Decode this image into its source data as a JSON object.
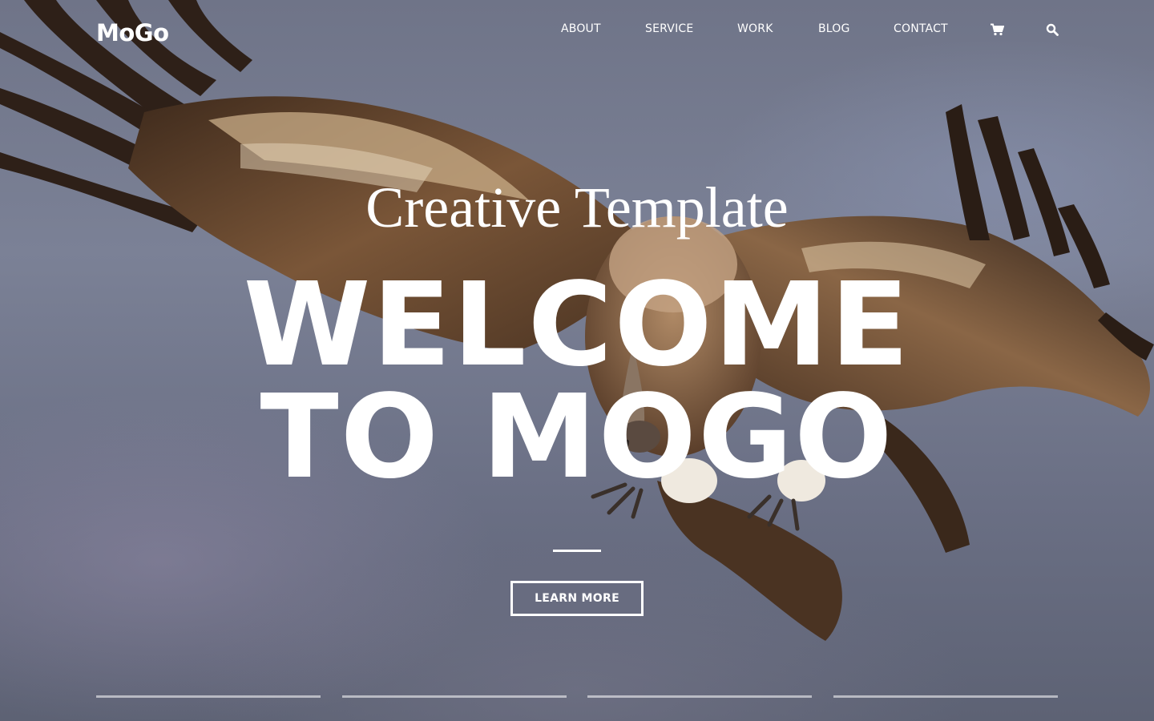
{
  "header": {
    "logo": "MoGo",
    "nav": [
      {
        "label": "ABOUT"
      },
      {
        "label": "SERVICE"
      },
      {
        "label": "WORK"
      },
      {
        "label": "BLOG"
      },
      {
        "label": "CONTACT"
      }
    ],
    "icons": [
      {
        "name": "shopping-cart-icon"
      },
      {
        "name": "search-icon"
      }
    ]
  },
  "hero": {
    "subtitle": "Creative Template",
    "title_line1": "WELCOME",
    "title_line2": "TO MOGO",
    "button_label": "LEARN MORE",
    "background": "vulture in flight"
  },
  "slider": {
    "bar_count": 4,
    "active_index": 0
  },
  "colors": {
    "text": "#ffffff",
    "sky": "#6f7488",
    "bird_brown": "#6b4a30"
  }
}
